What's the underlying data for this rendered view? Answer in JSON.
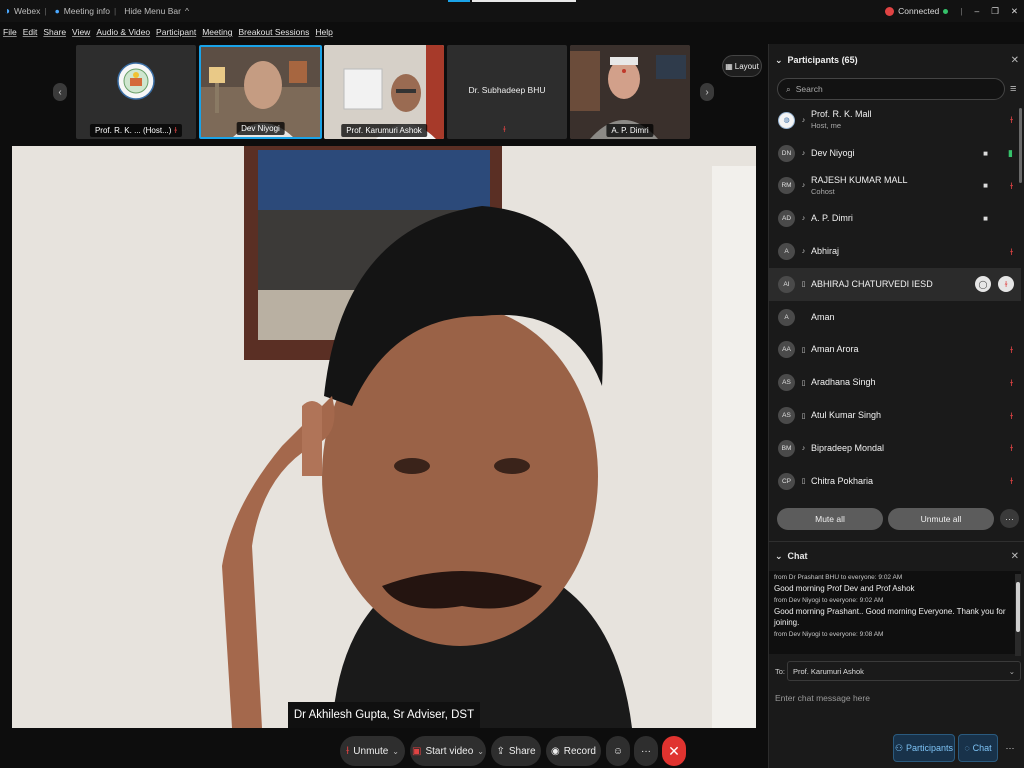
{
  "titlebar": {
    "app_name": "Webex",
    "meeting_info": "Meeting info",
    "hide_menu": "Hide Menu Bar",
    "status": "Connected"
  },
  "menubar": [
    "File",
    "Edit",
    "Share",
    "View",
    "Audio & Video",
    "Participant",
    "Meeting",
    "Breakout Sessions",
    "Help"
  ],
  "thumbnails": [
    {
      "label": "Prof. R. K. ... (Host...)",
      "muted": true
    },
    {
      "label": "Dev Niyogi",
      "muted": false,
      "active": true
    },
    {
      "label": "Prof. Karumuri Ashok",
      "muted": false
    },
    {
      "label": "",
      "center_name": "Dr. Subhadeep BHU",
      "muted": true
    },
    {
      "label": "A. P. Dimri",
      "muted": false
    }
  ],
  "layout_label": "Layout",
  "main_video": {
    "caption": "Dr Akhilesh Gupta, Sr Adviser, DST"
  },
  "controls": {
    "unmute": "Unmute",
    "start_video": "Start video",
    "share": "Share",
    "record": "Record",
    "more": "···",
    "end": "✕"
  },
  "participants": {
    "title": "Participants (65)",
    "search_placeholder": "Search",
    "list": [
      {
        "initials": "",
        "name": "Prof. R. K. Mall",
        "sub": "Host, me",
        "device": "mic",
        "mic": "muted",
        "cam": ""
      },
      {
        "initials": "DN",
        "name": "Dev Niyogi",
        "sub": "",
        "device": "mic",
        "mic": "active",
        "cam": "video"
      },
      {
        "initials": "RM",
        "name": "RAJESH KUMAR MALL",
        "sub": "Cohost",
        "device": "mic",
        "mic": "muted",
        "cam": "video"
      },
      {
        "initials": "AD",
        "name": "A. P. Dimri",
        "sub": "",
        "device": "mic",
        "mic": "",
        "cam": "video"
      },
      {
        "initials": "A",
        "name": "Abhiraj",
        "sub": "",
        "device": "mic",
        "mic": "muted",
        "cam": ""
      },
      {
        "initials": "AI",
        "name": "ABHIRAJ CHATURVEDI IESD",
        "sub": "",
        "device": "phone",
        "mic": "muted",
        "cam": "",
        "highlight": true
      },
      {
        "initials": "A",
        "name": "Aman",
        "sub": "",
        "device": "",
        "mic": "",
        "cam": ""
      },
      {
        "initials": "AA",
        "name": "Aman Arora",
        "sub": "",
        "device": "phone",
        "mic": "muted",
        "cam": ""
      },
      {
        "initials": "AS",
        "name": "Aradhana Singh",
        "sub": "",
        "device": "phone",
        "mic": "muted",
        "cam": ""
      },
      {
        "initials": "AS",
        "name": "Atul Kumar Singh",
        "sub": "",
        "device": "phone",
        "mic": "muted",
        "cam": ""
      },
      {
        "initials": "BM",
        "name": "Bipradeep Mondal",
        "sub": "",
        "device": "mic",
        "mic": "muted",
        "cam": ""
      },
      {
        "initials": "CP",
        "name": "Chitra Pokharia",
        "sub": "",
        "device": "phone",
        "mic": "muted",
        "cam": ""
      }
    ],
    "mute_all": "Mute all",
    "unmute_all": "Unmute all"
  },
  "chat": {
    "title": "Chat",
    "messages": [
      {
        "meta": "from Dr Prashant BHU to everyone:    9:02 AM",
        "text": "Good morning Prof Dev and Prof Ashok"
      },
      {
        "meta": "from Dev Niyogi to everyone:    9:02 AM",
        "text": "Good morning Prashant.. Good morning Everyone. Thank you for joining."
      },
      {
        "meta": "from Dev Niyogi to everyone:    9:08 AM",
        "text": ""
      }
    ],
    "to_label": "To:",
    "to_value": "Prof. Karumuri Ashok",
    "input_placeholder": "Enter chat message here"
  },
  "bottom_tabs": {
    "participants": "Participants",
    "chat": "Chat"
  },
  "colors": {
    "accent": "#1aa3e8",
    "danger": "#e0332f",
    "mic_muted": "#e04343",
    "mic_active": "#35c16a"
  }
}
